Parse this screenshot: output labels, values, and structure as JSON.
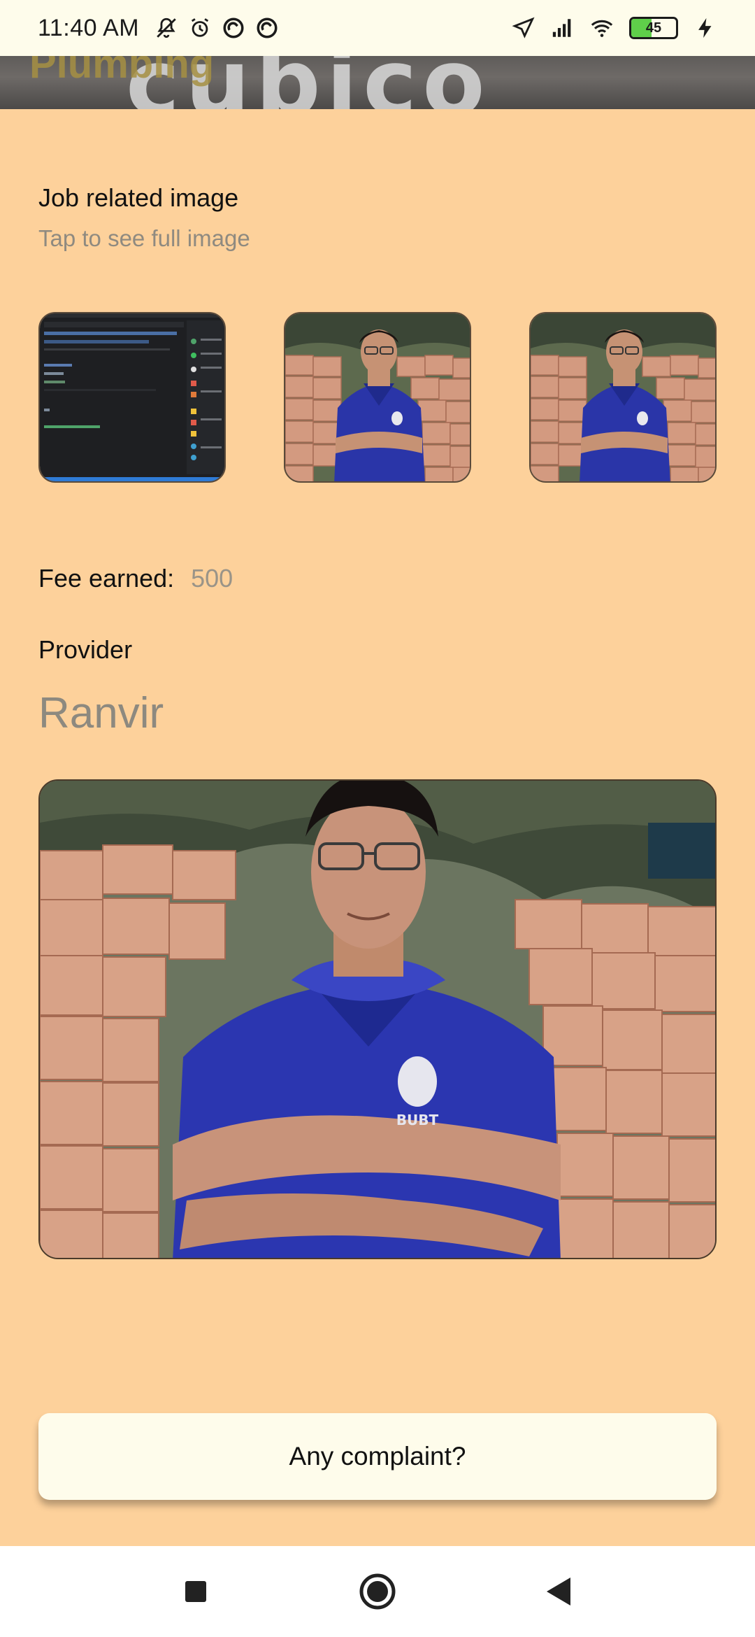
{
  "status_bar": {
    "time": "11:40 AM",
    "battery_level": "45",
    "icons": [
      "mute-icon",
      "alarm-icon",
      "sync-icon",
      "sync-icon",
      "location-icon",
      "signal-icon",
      "wifi-icon",
      "battery-icon",
      "charging-icon"
    ]
  },
  "header": {
    "category": "Plumbing",
    "brand": "cubico"
  },
  "job_images": {
    "title": "Job related image",
    "subtitle": "Tap to see full image"
  },
  "fee": {
    "label": "Fee earned:",
    "value": "500"
  },
  "provider": {
    "title": "Provider",
    "name": "Ranvir"
  },
  "complaint_button": {
    "label": "Any complaint?"
  },
  "colors": {
    "background": "#FDD19B",
    "surface": "#FEFCEB",
    "muted_text": "#8d897f"
  }
}
